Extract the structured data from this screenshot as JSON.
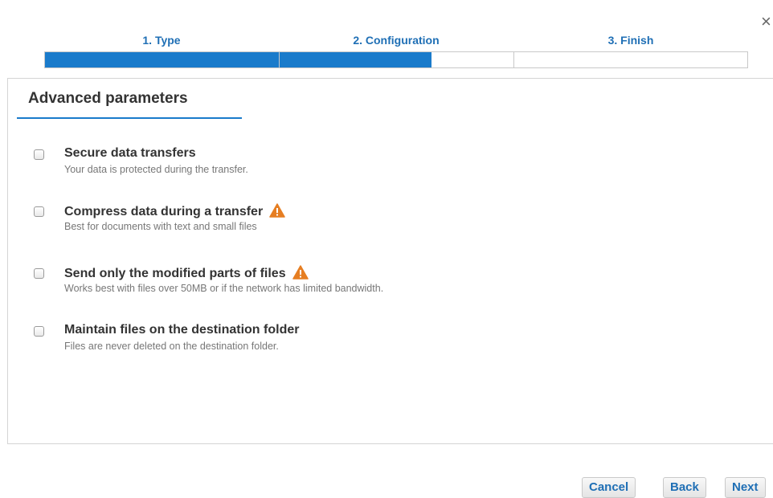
{
  "window": {
    "close_glyph": "×"
  },
  "steps": [
    "1. Type",
    "2. Configuration",
    "3. Finish"
  ],
  "progress_fraction": 0.55,
  "panel": {
    "title": "Advanced parameters"
  },
  "options": [
    {
      "title": "Secure data transfers",
      "description": "Your data is protected during the transfer.",
      "checked": false,
      "warning": false
    },
    {
      "title": "Compress data during a transfer",
      "description": "Best for documents with text and small files",
      "checked": false,
      "warning": true
    },
    {
      "title": "Send only the modified parts of files",
      "description": "Works best with files over 50MB or if the network has limited bandwidth.",
      "checked": false,
      "warning": true
    },
    {
      "title": "Maintain files on the destination folder",
      "description": "Files are never deleted on the destination folder.",
      "checked": false,
      "warning": false
    }
  ],
  "buttons": {
    "cancel": "Cancel",
    "back": "Back",
    "next": "Next"
  },
  "colors": {
    "accent": "#1a7bcb",
    "warning": "#e67e22"
  },
  "icons": {
    "close": "close-icon",
    "warning": "warning-triangle-icon",
    "checkbox": "checkbox"
  }
}
